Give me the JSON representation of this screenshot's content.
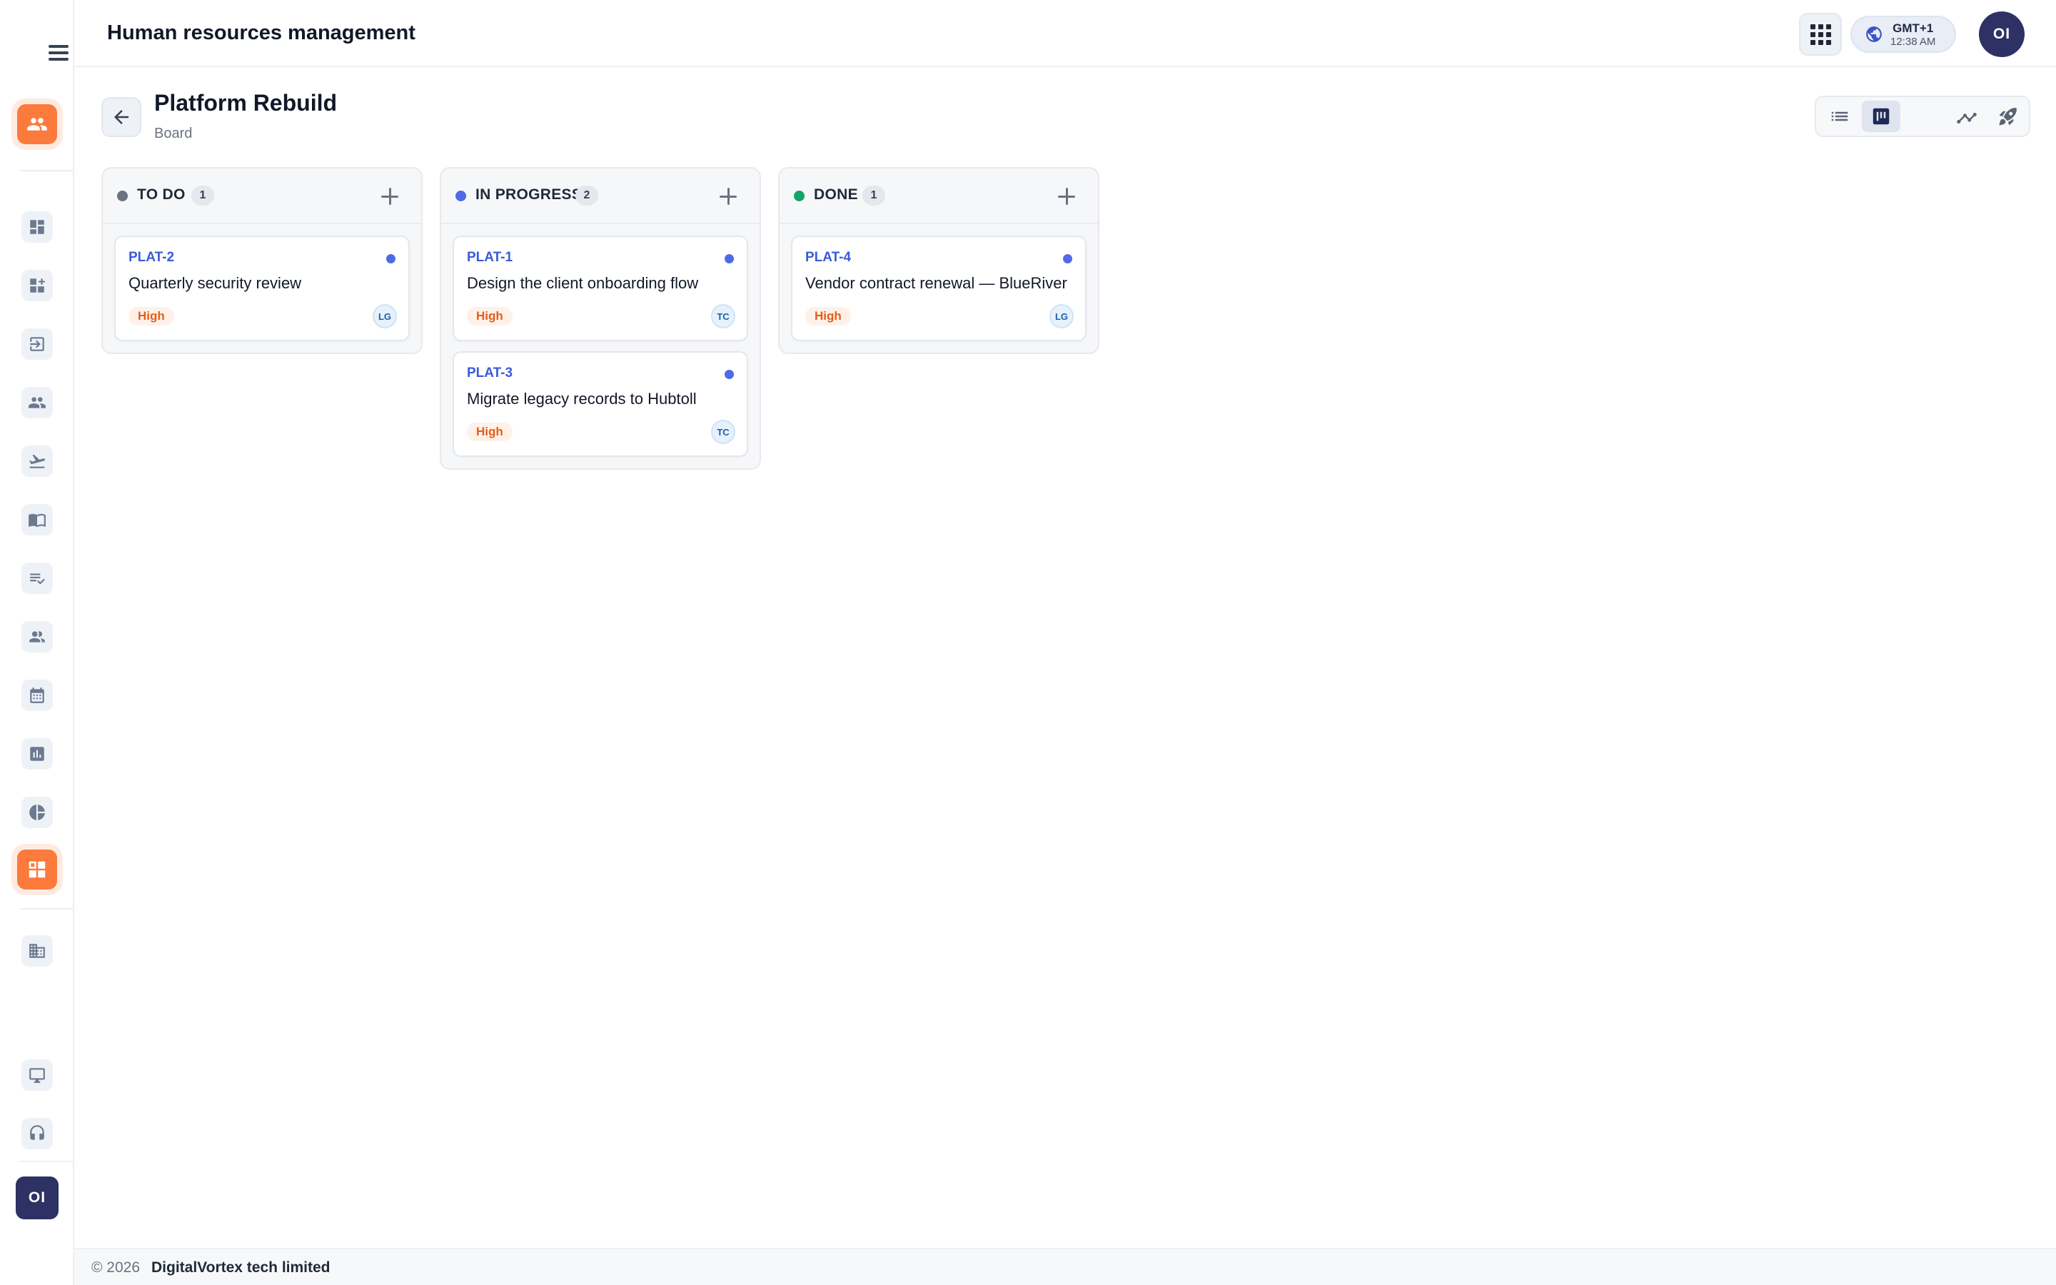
{
  "app": {
    "title": "Human resources management"
  },
  "topbar": {
    "timezone": {
      "zone": "GMT+1",
      "time": "12:38 AM"
    },
    "user_initials": "OI"
  },
  "sidebar": {
    "user_initials": "OI",
    "items": [
      {
        "icon": "people-icon",
        "active": true
      },
      {
        "icon": "dashboard-icon",
        "active": false
      },
      {
        "icon": "dashboard-add-icon",
        "active": false
      },
      {
        "icon": "login-icon",
        "active": false
      },
      {
        "icon": "people-icon",
        "active": false
      },
      {
        "icon": "flight-departure-icon",
        "active": false
      },
      {
        "icon": "book-icon",
        "active": false
      },
      {
        "icon": "checklist-icon",
        "active": false
      },
      {
        "icon": "group-icon",
        "active": false
      },
      {
        "icon": "calendar-icon",
        "active": false
      },
      {
        "icon": "bar-chart-icon",
        "active": false
      },
      {
        "icon": "pie-chart-icon",
        "active": false
      },
      {
        "icon": "project-board-icon",
        "active": true
      },
      {
        "icon": "building-icon",
        "active": false
      },
      {
        "icon": "desktop-icon",
        "active": false
      },
      {
        "icon": "headset-icon",
        "active": false
      }
    ]
  },
  "page": {
    "title": "Platform Rebuild",
    "subtitle": "Board",
    "views": [
      "list-view-icon",
      "board-view-icon",
      "trend-icon",
      "rocket-icon"
    ],
    "active_view": "board-view-icon"
  },
  "board": {
    "columns": [
      {
        "name": "TO DO",
        "count": "1",
        "dot_color": "#6b7280",
        "cards": [
          {
            "key": "PLAT-2",
            "title": "Quarterly security review",
            "priority": "High",
            "assignee": "LG"
          }
        ]
      },
      {
        "name": "IN PROGRESS",
        "count": "2",
        "dot_color": "#4f6ae8",
        "cards": [
          {
            "key": "PLAT-1",
            "title": "Design the client onboarding flow",
            "priority": "High",
            "assignee": "TC"
          },
          {
            "key": "PLAT-3",
            "title": "Migrate legacy records to Hubtoll",
            "priority": "High",
            "assignee": "TC"
          }
        ]
      },
      {
        "name": "DONE",
        "count": "1",
        "dot_color": "#16a36a",
        "cards": [
          {
            "key": "PLAT-4",
            "title": "Vendor contract renewal — BlueRiver",
            "priority": "High",
            "assignee": "LG"
          }
        ]
      }
    ]
  },
  "footer": {
    "copyright": "© 2026",
    "company": "DigitalVortex tech limited"
  },
  "colors": {
    "accent": "#fb7a3c",
    "primary": "#2e3164",
    "link": "#3a5bd9"
  }
}
